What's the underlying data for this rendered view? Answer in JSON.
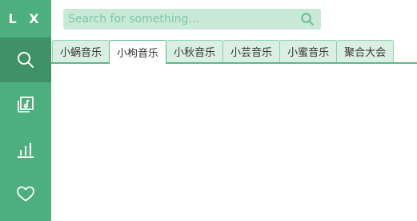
{
  "logo": {
    "text": "L X"
  },
  "sidebar": {
    "items": [
      {
        "name": "search",
        "icon": "search-icon",
        "active": true
      },
      {
        "name": "music-list",
        "icon": "music-list-icon",
        "active": false
      },
      {
        "name": "leaderboard",
        "icon": "bar-chart-icon",
        "active": false
      },
      {
        "name": "favorites",
        "icon": "heart-icon",
        "active": false
      }
    ]
  },
  "search": {
    "placeholder": "Search for something...",
    "value": "",
    "button_icon": "search-icon"
  },
  "tabs": [
    {
      "label": "小蜗音乐",
      "active": false
    },
    {
      "label": "小枸音乐",
      "active": true
    },
    {
      "label": "小秋音乐",
      "active": false
    },
    {
      "label": "小芸音乐",
      "active": false
    },
    {
      "label": "小蜜音乐",
      "active": false
    },
    {
      "label": "聚合大会",
      "active": false
    }
  ],
  "colors": {
    "sidebar": "#4caf7d",
    "sidebar_active": "#3f9268",
    "search_bg": "#c9e9d8",
    "tab_bg": "#d9efe3",
    "accent": "#5cb889"
  }
}
